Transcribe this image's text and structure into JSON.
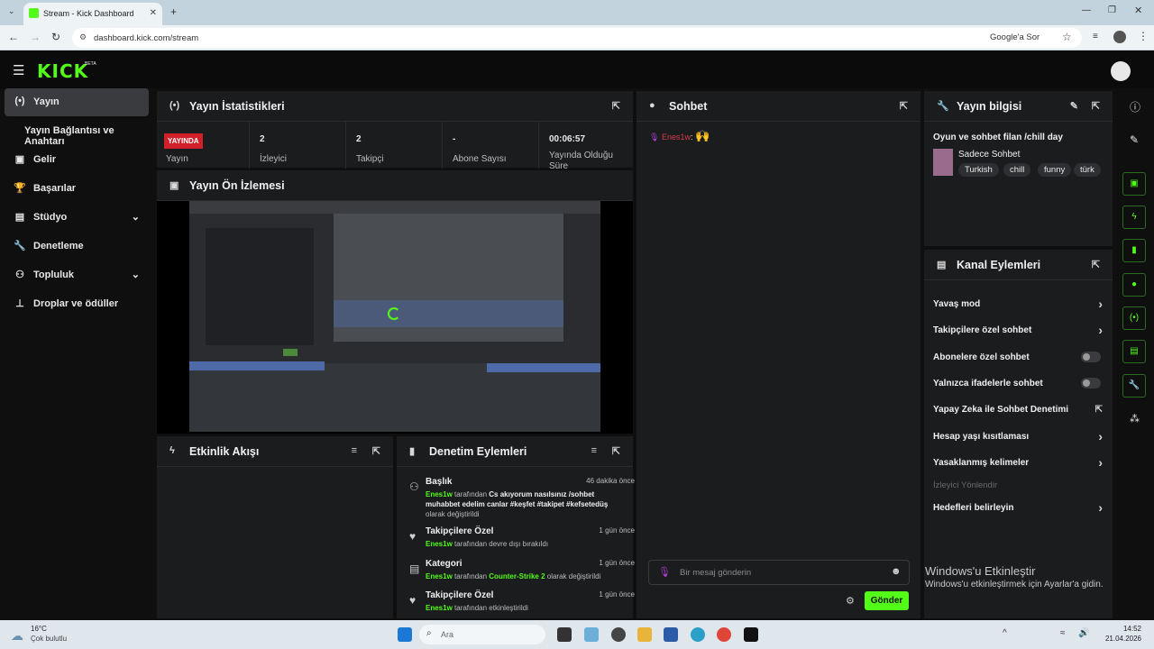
{
  "browser": {
    "tab_title": "Stream - Kick Dashboard",
    "url": "dashboard.kick.com/stream",
    "ask_google": "Google'a Sor"
  },
  "app": {
    "logo": "KICK",
    "logo_badge": "BETA"
  },
  "sidebar": {
    "items": [
      {
        "label": "Yayın",
        "icon": "broadcast-icon"
      },
      {
        "label": "Yayın Bağlantısı ve Anahtarı",
        "icon": ""
      },
      {
        "label": "Gelir",
        "icon": "dollar-icon"
      },
      {
        "label": "Başarılar",
        "icon": "trophy-icon"
      },
      {
        "label": "Stüdyo",
        "icon": "studio-icon"
      },
      {
        "label": "Denetleme",
        "icon": "wrench-icon"
      },
      {
        "label": "Topluluk",
        "icon": "community-icon"
      },
      {
        "label": "Droplar ve ödüller",
        "icon": "drops-icon"
      }
    ]
  },
  "stats": {
    "title": "Yayın İstatistikleri",
    "live_badge": "YAYINDA",
    "items": [
      {
        "value": "",
        "label": "Yayın"
      },
      {
        "value": "2",
        "label": "İzleyici"
      },
      {
        "value": "2",
        "label": "Takipçi"
      },
      {
        "value": "-",
        "label": "Abone Sayısı"
      },
      {
        "value": "00:06:57",
        "label": "Yayında Olduğu Süre"
      }
    ]
  },
  "preview": {
    "title": "Yayın Ön İzlemesi"
  },
  "activity": {
    "title": "Etkinlik Akışı"
  },
  "mod_actions": {
    "title": "Denetim Eylemleri",
    "items": [
      {
        "title": "Başlık",
        "time": "46 dakika önce",
        "user": "Enes1w",
        "pre": " tarafından ",
        "value": "Cs akıyorum nasılsınız /sohbet muhabbet edelim canlar #keşfet #takipet #kefsetedüş",
        "post": " olarak değiştirildi",
        "icon": "user-edit-icon"
      },
      {
        "title": "Takipçilere Özel",
        "time": "1 gün önce",
        "user": "Enes1w",
        "pre": " tarafından devre dışı bırakıldı",
        "value": "",
        "post": "",
        "icon": "heart-icon"
      },
      {
        "title": "Kategori",
        "time": "1 gün önce",
        "user": "Enes1w",
        "pre": " tarafından ",
        "value": "Counter-Strike 2",
        "post": " olarak değiştirildi",
        "icon": "category-icon"
      },
      {
        "title": "Takipçilere Özel",
        "time": "1 gün önce",
        "user": "Enes1w",
        "pre": " tarafından etkinleştirildi",
        "value": "",
        "post": "",
        "icon": "heart-icon"
      }
    ]
  },
  "chat": {
    "title": "Sohbet",
    "messages": [
      {
        "user": "Enes1w",
        "sep": ":",
        "text": "🙌"
      }
    ],
    "placeholder": "Bir mesaj gönderin",
    "send": "Gönder"
  },
  "stream_info": {
    "title": "Yayın bilgisi",
    "stream_title": "Oyun ve sohbet filan /chill day",
    "category": "Sadece Sohbet",
    "tags": [
      "Turkish",
      "chill",
      "funny",
      "türk"
    ]
  },
  "channel_actions": {
    "title": "Kanal Eylemleri",
    "items": [
      {
        "label": "Yavaş mod",
        "control": "chevron"
      },
      {
        "label": "Takipçilere özel sohbet",
        "control": "chevron"
      },
      {
        "label": "Abonelere özel sohbet",
        "control": "toggle"
      },
      {
        "label": "Yalnızca ifadelerle sohbet",
        "control": "toggle"
      },
      {
        "label": "Yapay Zeka ile Sohbet Denetimi",
        "control": "external"
      },
      {
        "label": "Hesap yaşı kısıtlaması",
        "control": "chevron"
      },
      {
        "label": "Yasaklanmış kelimeler",
        "control": "chevron"
      },
      {
        "label": "İzleyici Yönlendir",
        "control": "none"
      },
      {
        "label": "Hedefleri belirleyin",
        "control": "chevron"
      }
    ]
  },
  "watermark": {
    "line1": "Windows'u Etkinleştir",
    "line2": "Windows'u etkinleştirmek için Ayarlar'a gidin."
  },
  "taskbar": {
    "temp": "16°C",
    "weather": "Çok bulutlu",
    "search": "Ara",
    "time": "14:52",
    "date": "21.04.2026"
  },
  "colors": {
    "accent": "#53fc18",
    "live": "#d1202a",
    "panel": "#1b1c1e"
  }
}
